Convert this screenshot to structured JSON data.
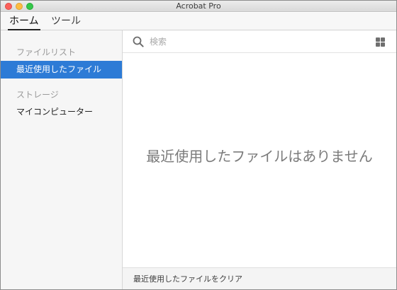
{
  "window": {
    "title": "Acrobat Pro"
  },
  "topnav": {
    "tabs": [
      {
        "label": "ホーム",
        "active": true
      },
      {
        "label": "ツール",
        "active": false
      }
    ]
  },
  "sidebar": {
    "sections": [
      {
        "heading": "ファイルリスト",
        "items": [
          {
            "label": "最近使用したファイル",
            "selected": true
          }
        ]
      },
      {
        "heading": "ストレージ",
        "items": [
          {
            "label": "マイコンピューター",
            "selected": false
          }
        ]
      }
    ]
  },
  "search": {
    "placeholder": "検索",
    "value": ""
  },
  "main": {
    "empty_message": "最近使用したファイルはありません",
    "clear_recent_label": "最近使用したファイルをクリア"
  },
  "icons": {
    "search": "search-icon",
    "view_toggle": "grid-view-icon"
  },
  "colors": {
    "selection": "#2d7bd6",
    "sidebar_bg": "#f6f6f6"
  }
}
